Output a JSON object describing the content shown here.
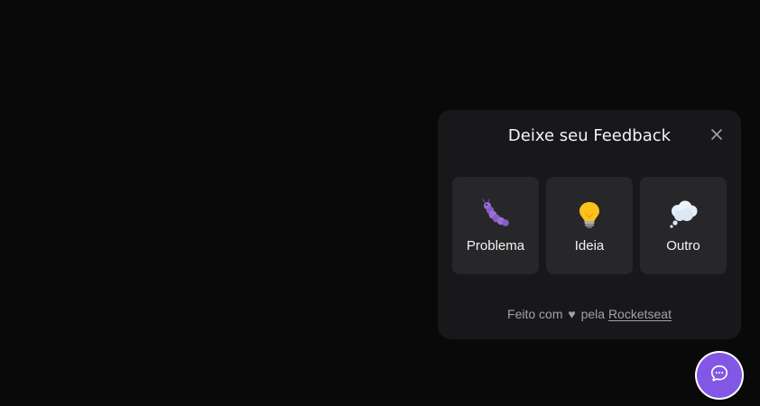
{
  "widget": {
    "title": "Deixe seu Feedback",
    "close_icon": "close-icon",
    "options": [
      {
        "label": "Problema",
        "icon": "bug-icon"
      },
      {
        "label": "Ideia",
        "icon": "lightbulb-icon"
      },
      {
        "label": "Outro",
        "icon": "thought-bubble-icon"
      }
    ],
    "footer": {
      "prefix": "Feito com",
      "heart": "♥",
      "middle": "pela",
      "link_label": "Rocketseat"
    }
  },
  "launcher": {
    "icon": "chat-bubble-icon"
  },
  "colors": {
    "background": "#09090a",
    "surface": "#18181b",
    "card": "#27272a",
    "accent": "#8257e5",
    "text": "#f4f4f5",
    "muted": "#a1a1aa"
  }
}
